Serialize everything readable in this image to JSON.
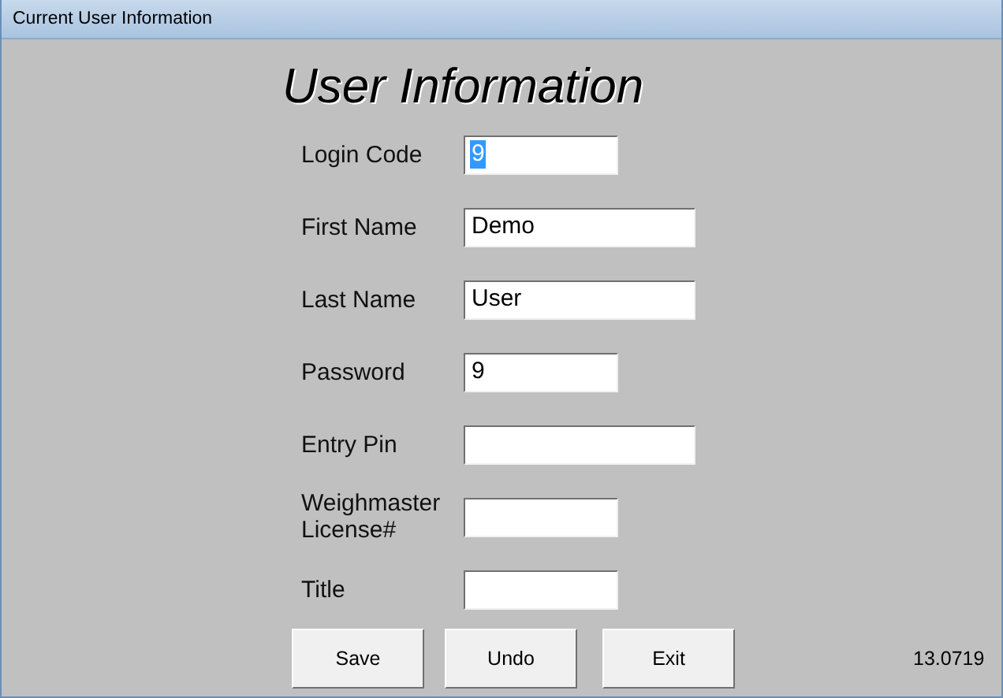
{
  "window": {
    "title": "Current User Information"
  },
  "heading": "User Information",
  "fields": [
    {
      "label": "Login Code",
      "value": "9",
      "kind": "short",
      "highlighted": true
    },
    {
      "label": "First Name",
      "value": "Demo",
      "kind": "long",
      "highlighted": false
    },
    {
      "label": "Last Name",
      "value": "User",
      "kind": "long",
      "highlighted": false
    },
    {
      "label": "Password",
      "value": "9",
      "kind": "short",
      "highlighted": false
    },
    {
      "label": "Entry Pin",
      "kind": "long"
    },
    {
      "label": "Weighmaster License#",
      "kind": "short"
    },
    {
      "label": "Title",
      "kind": "short"
    }
  ],
  "buttons": [
    "Save",
    "Undo",
    "Exit"
  ],
  "version": "13.0719"
}
